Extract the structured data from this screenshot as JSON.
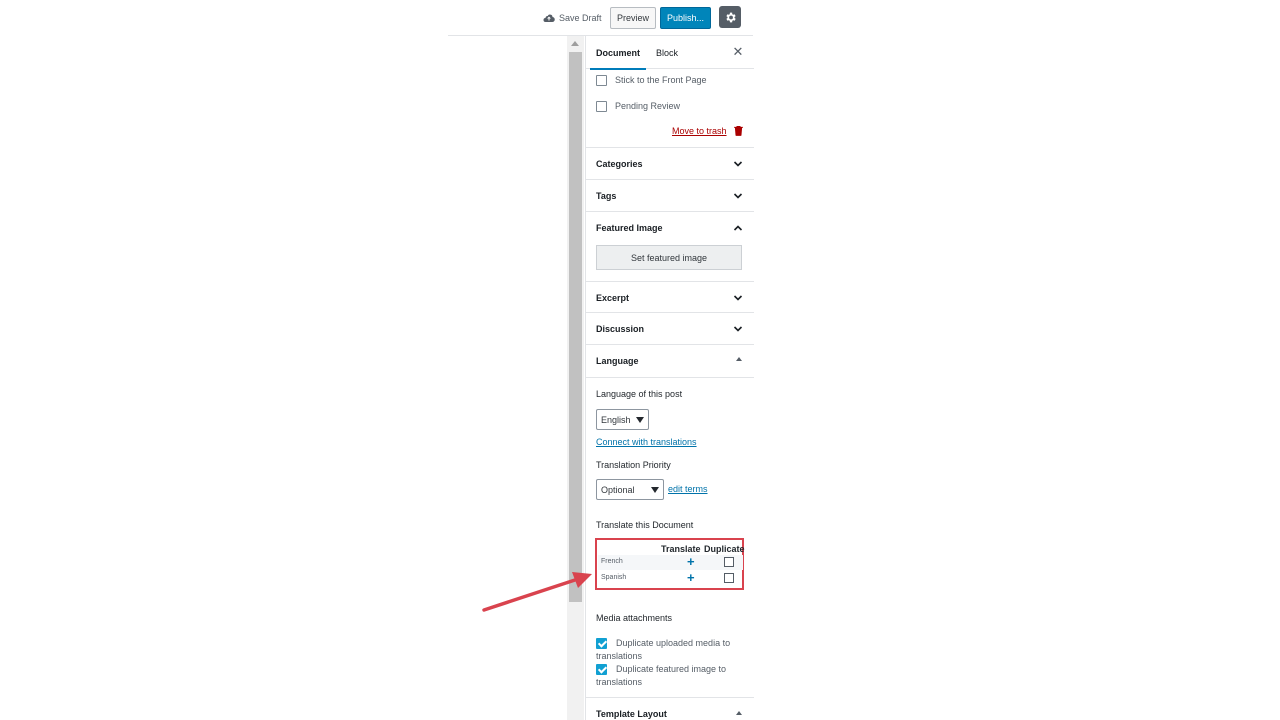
{
  "toolbar": {
    "save_draft": "Save Draft",
    "preview": "Preview",
    "publish": "Publish...",
    "settings_icon": "gear-icon"
  },
  "sidebar": {
    "tabs": [
      {
        "label": "Document",
        "active": true
      },
      {
        "label": "Block",
        "active": false
      }
    ],
    "status": {
      "stick_front": "Stick to the Front Page",
      "pending_review": "Pending Review",
      "move_to_trash": "Move to trash"
    },
    "panels": {
      "categories": "Categories",
      "tags": "Tags",
      "featured_image": "Featured Image",
      "set_featured_image": "Set featured image",
      "excerpt": "Excerpt",
      "discussion": "Discussion",
      "language": "Language",
      "template_layout": "Template Layout"
    },
    "language_panel": {
      "language_of_post_label": "Language of this post",
      "language_selected": "English",
      "connect_link": "Connect with translations",
      "translation_priority_label": "Translation Priority",
      "priority_selected": "Optional",
      "edit_terms_link": "edit terms",
      "translate_doc_label": "Translate this Document",
      "col_translate": "Translate",
      "col_duplicate": "Duplicate",
      "languages": [
        {
          "name": "French",
          "duplicate": false
        },
        {
          "name": "Spanish",
          "duplicate": false
        }
      ],
      "media_label": "Media attachments",
      "media_options": [
        {
          "label": "Duplicate uploaded media to translations",
          "checked": true
        },
        {
          "label": "Duplicate featured image to translations",
          "checked": true
        }
      ]
    }
  },
  "colors": {
    "accent": "#0085ba",
    "highlight_box": "#d9434e",
    "arrow": "#d9434e"
  }
}
